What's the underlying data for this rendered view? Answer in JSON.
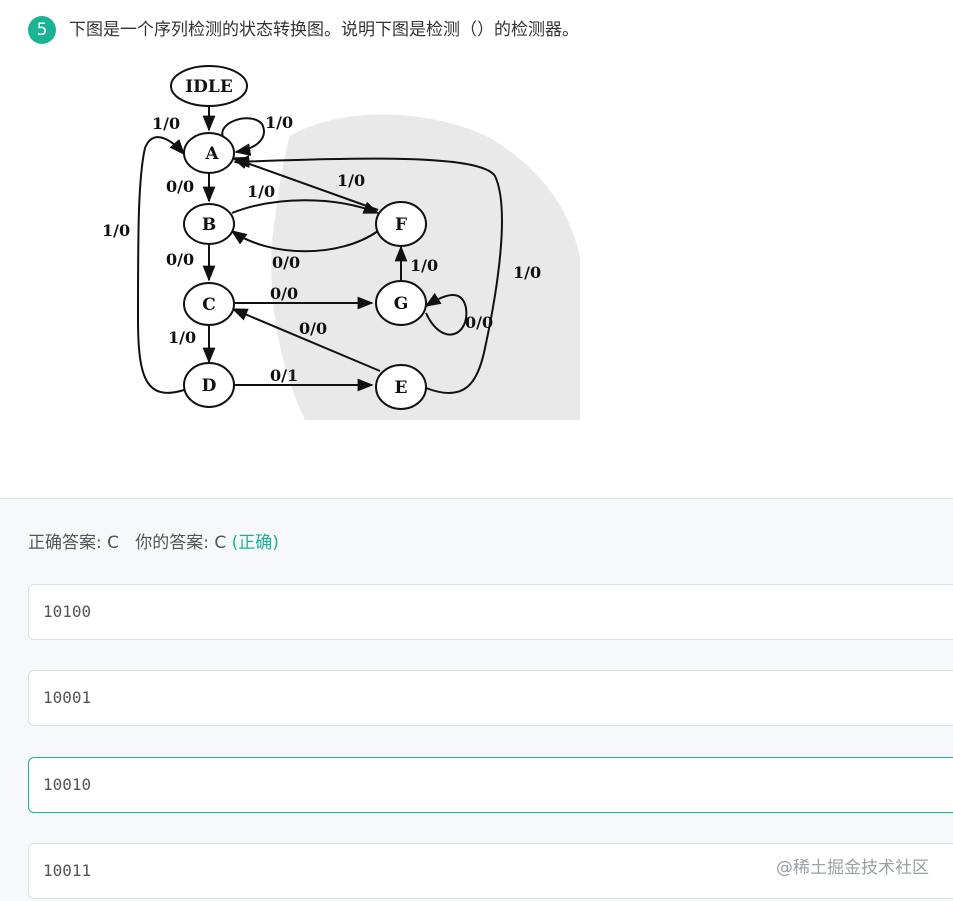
{
  "question": {
    "number": "5",
    "text": "下图是一个序列检测的状态转换图。说明下图是检测（）的检测器。"
  },
  "diagram": {
    "states": {
      "idle": "IDLE",
      "a": "A",
      "b": "B",
      "c": "C",
      "d": "D",
      "e": "E",
      "f": "F",
      "g": "G"
    },
    "edges": {
      "idle_a": "1/0",
      "a_self": "1/0",
      "a_b": "0/0",
      "b_f": "1/0",
      "f_b": "0/0",
      "f_a": "1/0",
      "b_c": "0/0",
      "c_g": "0/0",
      "g_f": "1/0",
      "g_self": "0/0",
      "c_d": "1/0",
      "e_c": "0/0",
      "d_a": "1/0",
      "d_e": "0/1",
      "e_a": "1/0"
    }
  },
  "answer": {
    "correct_label": "正确答案: ",
    "correct_value": "C",
    "yours_label": "你的答案: ",
    "yours_value": "C",
    "status": "(正确)"
  },
  "options": [
    "10100",
    "10001",
    "10010",
    "10011"
  ],
  "watermark": "@稀土掘金技术社区",
  "colors": {
    "accent": "#1ab394",
    "border": "#dcdfe6",
    "panel": "#f7f8fa"
  }
}
